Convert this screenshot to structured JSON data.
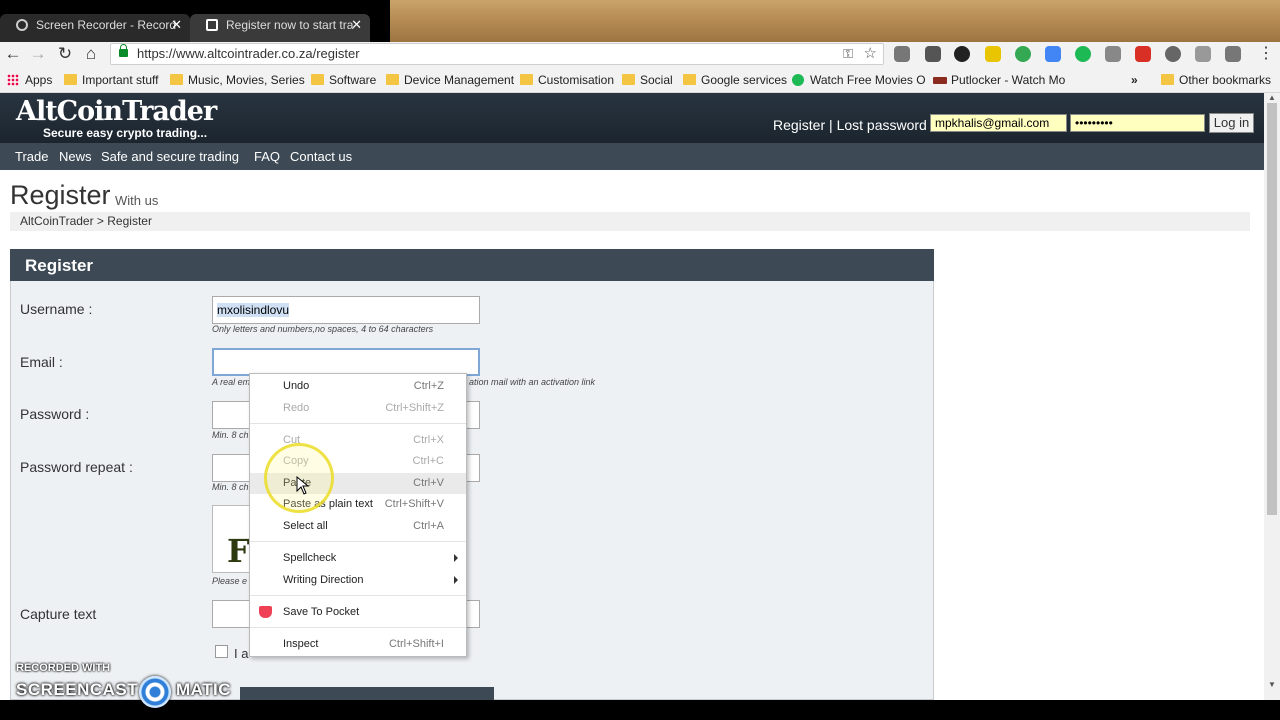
{
  "browser": {
    "tabs": [
      {
        "title": "Screen Recorder - Record",
        "active": false
      },
      {
        "title": "Register now to start tra",
        "active": true
      }
    ],
    "url": "https://www.altcointrader.co.za/register",
    "bookmarks": [
      {
        "label": "Apps",
        "icon": "apps-grid-icon"
      },
      {
        "label": "Important stuff",
        "icon": "folder-icon"
      },
      {
        "label": "Music, Movies, Series",
        "icon": "folder-icon"
      },
      {
        "label": "Software",
        "icon": "folder-icon"
      },
      {
        "label": "Device Management",
        "icon": "folder-icon"
      },
      {
        "label": "Customisation",
        "icon": "folder-icon"
      },
      {
        "label": "Social",
        "icon": "folder-icon"
      },
      {
        "label": "Google services",
        "icon": "folder-icon"
      },
      {
        "label": "Watch Free Movies O",
        "icon": "play-icon"
      },
      {
        "label": "Putlocker - Watch Mo",
        "icon": "putlocker-icon"
      },
      {
        "label": "»",
        "icon": "overflow-chevron-icon"
      },
      {
        "label": "Other bookmarks",
        "icon": "folder-icon"
      }
    ]
  },
  "site": {
    "logo": "AltCoinTrader",
    "tagline": "Secure easy crypto trading...",
    "header_links": {
      "register": "Register",
      "separator": "|",
      "lost_password": "Lost password"
    },
    "login": {
      "email": "mpkhalis@gmail.com",
      "password": "•••••••••",
      "button": "Log in"
    },
    "nav": [
      "Trade",
      "News",
      "Safe and secure trading",
      "FAQ",
      "Contact us"
    ],
    "colors": {
      "header": "#1c252e",
      "nav": "#3d4a55",
      "input_fill": "#ffffc0"
    }
  },
  "page": {
    "title": "Register",
    "subtitle": "With us",
    "breadcrumb": "AltCoinTrader > Register"
  },
  "form": {
    "title": "Register",
    "username": {
      "label": "Username :",
      "value": "mxolisindlovu",
      "help": "Only letters and numbers,no spaces, 4 to 64 characters"
    },
    "email": {
      "label": "Email :",
      "value": "",
      "help_start": "A real em",
      "help_end": "ation mail with an activation link"
    },
    "password": {
      "label": "Password :",
      "help": "Min. 8 ch"
    },
    "password_repeat": {
      "label": "Password repeat :",
      "help": "Min. 8 ch"
    },
    "captcha": {
      "partial_char": "F",
      "help": "Please e"
    },
    "capture": {
      "label": "Capture text"
    },
    "agree_text": "I a"
  },
  "context_menu": {
    "items": [
      {
        "label": "Undo",
        "shortcut": "Ctrl+Z",
        "disabled": false
      },
      {
        "label": "Redo",
        "shortcut": "Ctrl+Shift+Z",
        "disabled": true
      },
      {
        "label": "Cut",
        "shortcut": "Ctrl+X",
        "disabled": true
      },
      {
        "label": "Copy",
        "shortcut": "Ctrl+C",
        "disabled": true
      },
      {
        "label": "Paste",
        "shortcut": "Ctrl+V",
        "disabled": false
      },
      {
        "label": "Paste as plain text",
        "shortcut": "Ctrl+Shift+V",
        "disabled": false
      },
      {
        "label": "Select all",
        "shortcut": "Ctrl+A",
        "disabled": false
      },
      {
        "label": "Spellcheck",
        "shortcut": "",
        "disabled": false
      },
      {
        "label": "Writing Direction",
        "shortcut": "",
        "disabled": false
      },
      {
        "label": "Save To Pocket",
        "shortcut": "",
        "disabled": false
      },
      {
        "label": "Inspect",
        "shortcut": "Ctrl+Shift+I",
        "disabled": false
      }
    ]
  },
  "watermark": {
    "line1": "RECORDED WITH",
    "left": "SCREENCAST",
    "right": "MATIC"
  }
}
